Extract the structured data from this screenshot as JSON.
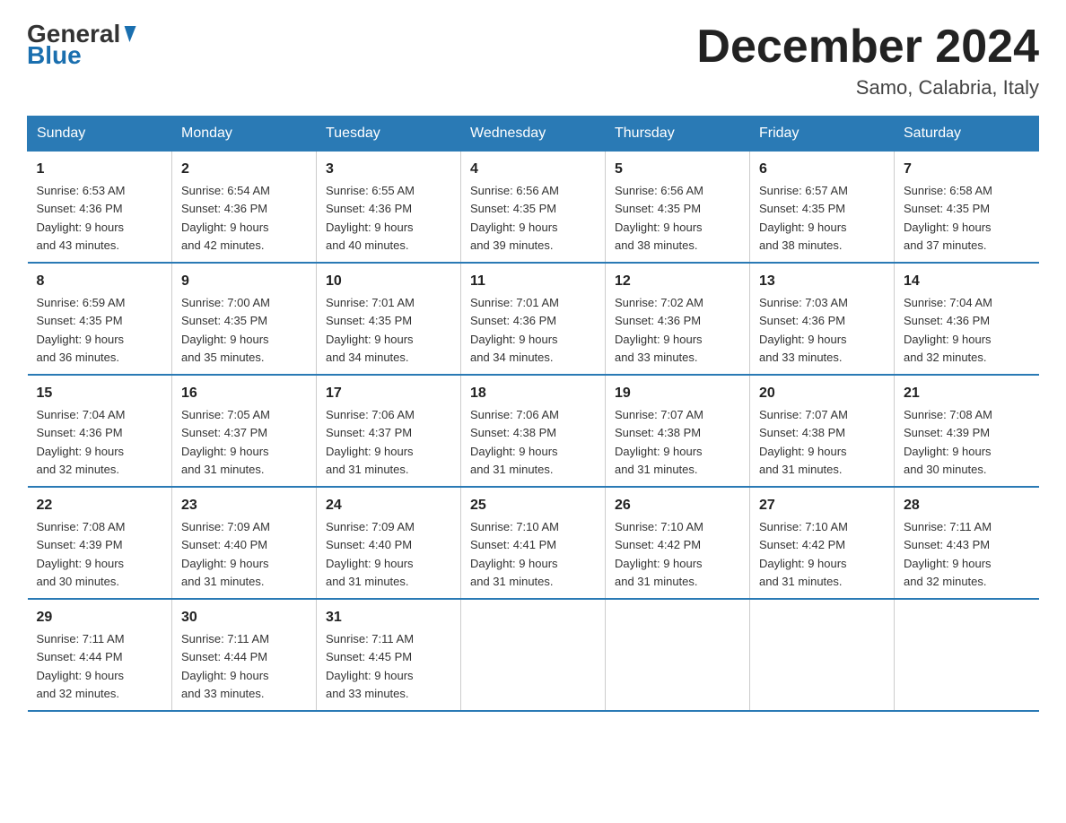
{
  "header": {
    "logo_line1": "General",
    "logo_line2": "Blue",
    "title": "December 2024",
    "subtitle": "Samo, Calabria, Italy"
  },
  "days_of_week": [
    "Sunday",
    "Monday",
    "Tuesday",
    "Wednesday",
    "Thursday",
    "Friday",
    "Saturday"
  ],
  "weeks": [
    [
      {
        "day": "1",
        "sunrise": "6:53 AM",
        "sunset": "4:36 PM",
        "daylight": "9 hours and 43 minutes."
      },
      {
        "day": "2",
        "sunrise": "6:54 AM",
        "sunset": "4:36 PM",
        "daylight": "9 hours and 42 minutes."
      },
      {
        "day": "3",
        "sunrise": "6:55 AM",
        "sunset": "4:36 PM",
        "daylight": "9 hours and 40 minutes."
      },
      {
        "day": "4",
        "sunrise": "6:56 AM",
        "sunset": "4:35 PM",
        "daylight": "9 hours and 39 minutes."
      },
      {
        "day": "5",
        "sunrise": "6:56 AM",
        "sunset": "4:35 PM",
        "daylight": "9 hours and 38 minutes."
      },
      {
        "day": "6",
        "sunrise": "6:57 AM",
        "sunset": "4:35 PM",
        "daylight": "9 hours and 38 minutes."
      },
      {
        "day": "7",
        "sunrise": "6:58 AM",
        "sunset": "4:35 PM",
        "daylight": "9 hours and 37 minutes."
      }
    ],
    [
      {
        "day": "8",
        "sunrise": "6:59 AM",
        "sunset": "4:35 PM",
        "daylight": "9 hours and 36 minutes."
      },
      {
        "day": "9",
        "sunrise": "7:00 AM",
        "sunset": "4:35 PM",
        "daylight": "9 hours and 35 minutes."
      },
      {
        "day": "10",
        "sunrise": "7:01 AM",
        "sunset": "4:35 PM",
        "daylight": "9 hours and 34 minutes."
      },
      {
        "day": "11",
        "sunrise": "7:01 AM",
        "sunset": "4:36 PM",
        "daylight": "9 hours and 34 minutes."
      },
      {
        "day": "12",
        "sunrise": "7:02 AM",
        "sunset": "4:36 PM",
        "daylight": "9 hours and 33 minutes."
      },
      {
        "day": "13",
        "sunrise": "7:03 AM",
        "sunset": "4:36 PM",
        "daylight": "9 hours and 33 minutes."
      },
      {
        "day": "14",
        "sunrise": "7:04 AM",
        "sunset": "4:36 PM",
        "daylight": "9 hours and 32 minutes."
      }
    ],
    [
      {
        "day": "15",
        "sunrise": "7:04 AM",
        "sunset": "4:36 PM",
        "daylight": "9 hours and 32 minutes."
      },
      {
        "day": "16",
        "sunrise": "7:05 AM",
        "sunset": "4:37 PM",
        "daylight": "9 hours and 31 minutes."
      },
      {
        "day": "17",
        "sunrise": "7:06 AM",
        "sunset": "4:37 PM",
        "daylight": "9 hours and 31 minutes."
      },
      {
        "day": "18",
        "sunrise": "7:06 AM",
        "sunset": "4:38 PM",
        "daylight": "9 hours and 31 minutes."
      },
      {
        "day": "19",
        "sunrise": "7:07 AM",
        "sunset": "4:38 PM",
        "daylight": "9 hours and 31 minutes."
      },
      {
        "day": "20",
        "sunrise": "7:07 AM",
        "sunset": "4:38 PM",
        "daylight": "9 hours and 31 minutes."
      },
      {
        "day": "21",
        "sunrise": "7:08 AM",
        "sunset": "4:39 PM",
        "daylight": "9 hours and 30 minutes."
      }
    ],
    [
      {
        "day": "22",
        "sunrise": "7:08 AM",
        "sunset": "4:39 PM",
        "daylight": "9 hours and 30 minutes."
      },
      {
        "day": "23",
        "sunrise": "7:09 AM",
        "sunset": "4:40 PM",
        "daylight": "9 hours and 31 minutes."
      },
      {
        "day": "24",
        "sunrise": "7:09 AM",
        "sunset": "4:40 PM",
        "daylight": "9 hours and 31 minutes."
      },
      {
        "day": "25",
        "sunrise": "7:10 AM",
        "sunset": "4:41 PM",
        "daylight": "9 hours and 31 minutes."
      },
      {
        "day": "26",
        "sunrise": "7:10 AM",
        "sunset": "4:42 PM",
        "daylight": "9 hours and 31 minutes."
      },
      {
        "day": "27",
        "sunrise": "7:10 AM",
        "sunset": "4:42 PM",
        "daylight": "9 hours and 31 minutes."
      },
      {
        "day": "28",
        "sunrise": "7:11 AM",
        "sunset": "4:43 PM",
        "daylight": "9 hours and 32 minutes."
      }
    ],
    [
      {
        "day": "29",
        "sunrise": "7:11 AM",
        "sunset": "4:44 PM",
        "daylight": "9 hours and 32 minutes."
      },
      {
        "day": "30",
        "sunrise": "7:11 AM",
        "sunset": "4:44 PM",
        "daylight": "9 hours and 33 minutes."
      },
      {
        "day": "31",
        "sunrise": "7:11 AM",
        "sunset": "4:45 PM",
        "daylight": "9 hours and 33 minutes."
      },
      {
        "day": "",
        "sunrise": "",
        "sunset": "",
        "daylight": ""
      },
      {
        "day": "",
        "sunrise": "",
        "sunset": "",
        "daylight": ""
      },
      {
        "day": "",
        "sunrise": "",
        "sunset": "",
        "daylight": ""
      },
      {
        "day": "",
        "sunrise": "",
        "sunset": "",
        "daylight": ""
      }
    ]
  ]
}
